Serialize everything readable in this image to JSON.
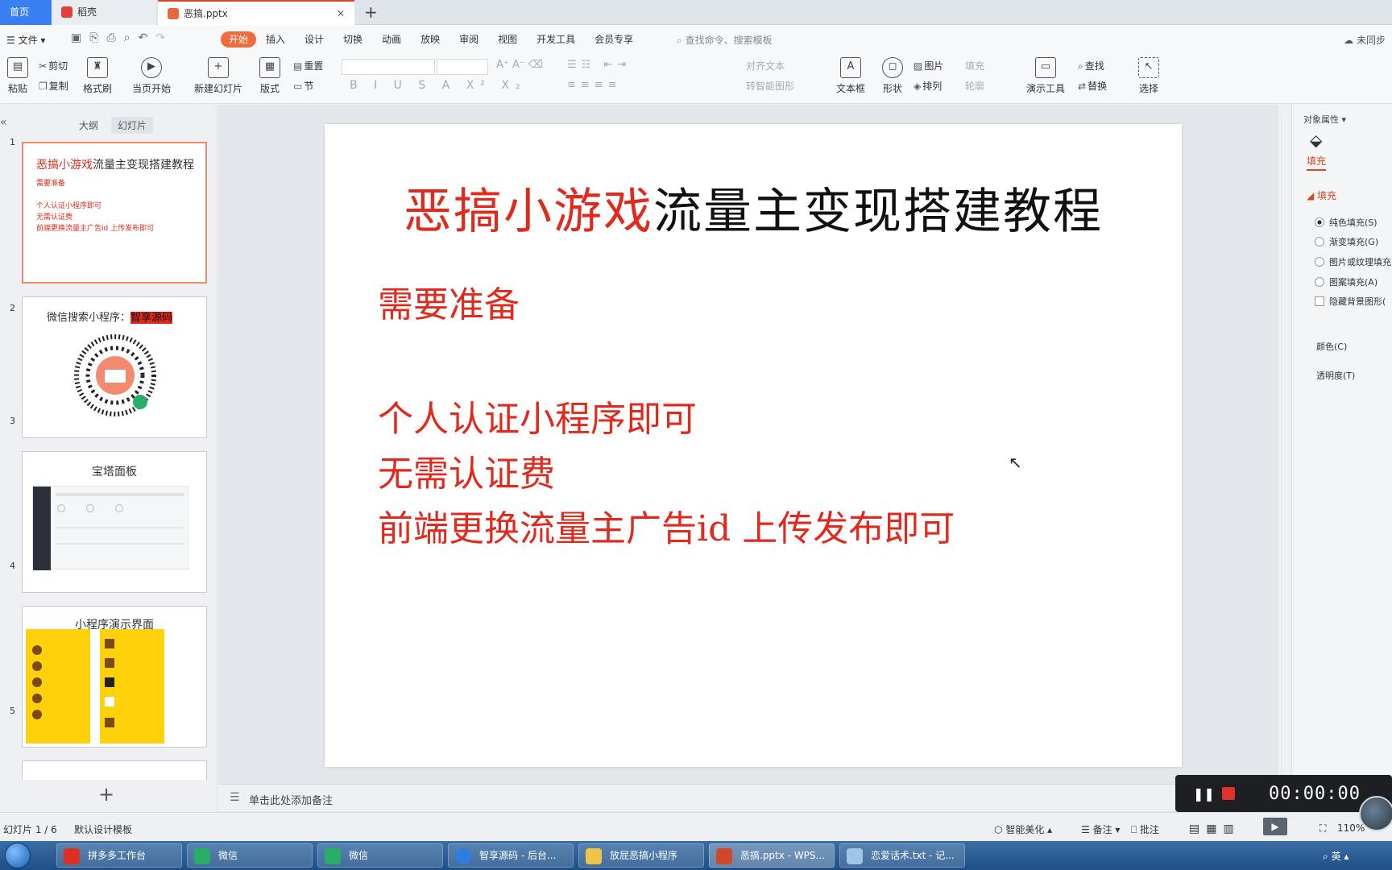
{
  "tabs": {
    "home": "首页",
    "daoke": "稻壳",
    "file": "恶搞.pptx"
  },
  "menu": {
    "file": "文件",
    "tabs": [
      "开始",
      "插入",
      "设计",
      "切换",
      "动画",
      "放映",
      "审阅",
      "视图",
      "开发工具",
      "会员专享"
    ],
    "search_placeholder": "查找命令、搜索模板",
    "sync": "未同步"
  },
  "ribbon": {
    "paste": "粘贴",
    "cut": "剪切",
    "copy": "复制",
    "format_painter": "格式刷",
    "from_current": "当页开始",
    "new_slide": "新建幻灯片",
    "layout": "版式",
    "reset": "重置",
    "section": "节",
    "align_text": "对齐文本",
    "smartart": "转智能图形",
    "textbox": "文本框",
    "shape": "形状",
    "picture": "图片",
    "arrange": "排列",
    "fill": "填充",
    "outline": "轮廓",
    "present_tools": "演示工具",
    "find": "查找",
    "replace": "替换",
    "select": "选择"
  },
  "left_panel": {
    "tab_outline": "大纲",
    "tab_slides": "幻灯片",
    "slides": [
      {
        "num": "1",
        "title_red": "恶搞小游戏",
        "title_black": "流量主变现搭建教程",
        "lines": [
          "需要准备",
          "个人认证小程序即可",
          "无需认证费",
          "前端更换流量主广告id 上传发布即可"
        ]
      },
      {
        "num": "2",
        "title": "微信搜索小程序：",
        "title_highlight": "智享源码"
      },
      {
        "num": "3",
        "title": "宝塔面板"
      },
      {
        "num": "4",
        "title": "小程序演示界面"
      },
      {
        "num": "5"
      }
    ]
  },
  "slide": {
    "title_red": "恶搞小游戏",
    "title_black": "流量主变现搭建教程",
    "subtitle": "需要准备",
    "lines": [
      "个人认证小程序即可",
      "无需认证费",
      "前端更换流量主广告id 上传发布即可"
    ]
  },
  "notes_placeholder": "单击此处添加备注",
  "right_panel": {
    "header": "对象属性",
    "fill_tab": "填充",
    "fill_section": "填充",
    "options": [
      "纯色填充(S)",
      "渐变填充(G)",
      "图片或纹理填充",
      "图案填充(A)"
    ],
    "hide_bg": "隐藏背景图形(",
    "color": "颜色(C)",
    "transparency": "透明度(T)"
  },
  "status": {
    "slide_count": "幻灯片 1 / 6",
    "template": "默认设计模板",
    "beautify": "智能美化",
    "notes": "备注",
    "comment": "批注",
    "zoom": "110%"
  },
  "recorder": {
    "time": "00:00:00"
  },
  "taskbar": {
    "items": [
      "拼多多工作台",
      "微信",
      "微信",
      "智享源码 - 后台...",
      "放屁恶搞小程序",
      "恶搞.pptx - WPS...",
      "恋爱话术.txt - 记..."
    ],
    "tray": "英"
  },
  "colors": {
    "accent": "#f26b3a",
    "slide_red": "#e02a1e",
    "home_tab": "#3a7ff2",
    "taskbar": "#1e4f86"
  }
}
